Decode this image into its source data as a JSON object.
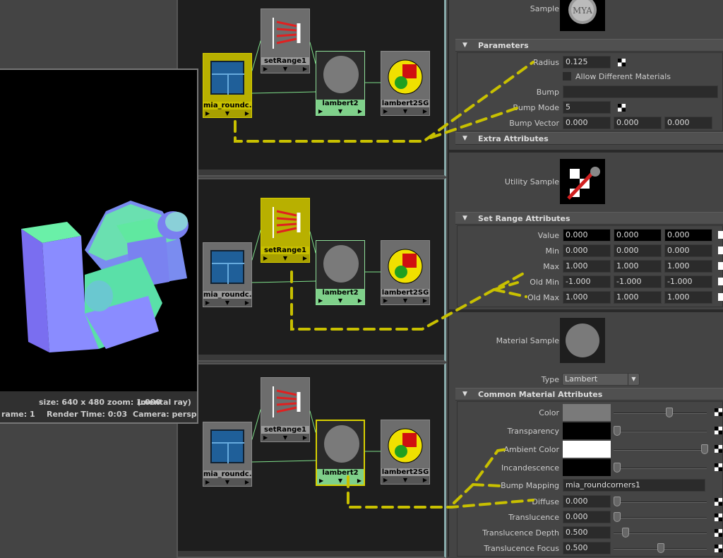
{
  "render_view": {
    "size_line": "size: 640 x 480 zoom: 1.000",
    "renderer": "(mental ray)",
    "frame": "rame: 1",
    "render_time": "Render Time: 0:03",
    "camera": "Camera: persp"
  },
  "hypershade": {
    "panels": [
      {
        "selected": "mia_roundcorners",
        "nodes": {
          "mia": "mia_roundc...",
          "setrange": "setRange1",
          "lambert": "lambert2",
          "sg": "lambert2SG"
        }
      },
      {
        "selected": "setRange1",
        "nodes": {
          "mia": "mia_roundc...",
          "setrange": "setRange1",
          "lambert": "lambert2",
          "sg": "lambert2SG"
        }
      },
      {
        "selected": "lambert2",
        "nodes": {
          "mia": "mia_roundc...",
          "setrange": "setRange1",
          "lambert": "lambert2",
          "sg": "lambert2SG"
        }
      }
    ]
  },
  "attribute_editor": {
    "sample_label": "Sample",
    "parameters": {
      "title": "Parameters",
      "radius_label": "Radius",
      "radius": "0.125",
      "allow_diff_label": "Allow Different Materials",
      "allow_diff_checked": false,
      "bump_label": "Bump",
      "bump": "",
      "bump_mode_label": "Bump Mode",
      "bump_mode": "5",
      "bump_vector_label": "Bump Vector",
      "bump_vector": [
        "0.000",
        "0.000",
        "0.000"
      ]
    },
    "extra_title": "Extra Attributes",
    "utility_sample_label": "Utility Sample",
    "set_range": {
      "title": "Set Range Attributes",
      "rows": [
        {
          "label": "Value",
          "values": [
            "0.000",
            "0.000",
            "0.000"
          ]
        },
        {
          "label": "Min",
          "values": [
            "0.000",
            "0.000",
            "0.000"
          ]
        },
        {
          "label": "Max",
          "values": [
            "1.000",
            "1.000",
            "1.000"
          ]
        },
        {
          "label": "Old Min",
          "values": [
            "-1.000",
            "-1.000",
            "-1.000"
          ]
        },
        {
          "label": "Old Max",
          "values": [
            "1.000",
            "1.000",
            "1.000"
          ]
        }
      ]
    },
    "material_sample_label": "Material Sample",
    "type_label": "Type",
    "type_value": "Lambert",
    "common": {
      "title": "Common Material Attributes",
      "color_rows": [
        {
          "label": "Color",
          "color": "#7a7a7a",
          "slider": 0.6
        },
        {
          "label": "Transparency",
          "color": "#000000",
          "slider": 0.0
        },
        {
          "label": "Ambient Color",
          "color": "#ffffff",
          "slider": 1.0
        },
        {
          "label": "Incandescence",
          "color": "#000000",
          "slider": 0.0
        }
      ],
      "bump_mapping_label": "Bump Mapping",
      "bump_mapping": "mia_roundcorners1",
      "num_rows": [
        {
          "label": "Diffuse",
          "value": "0.000",
          "slider": 0.0
        },
        {
          "label": "Translucence",
          "value": "0.000",
          "slider": 0.0
        },
        {
          "label": "Translucence Depth",
          "value": "0.500",
          "slider": 0.1
        },
        {
          "label": "Translucence Focus",
          "value": "0.500",
          "slider": 0.5
        }
      ]
    }
  },
  "colors": {
    "annotation": "#c8c000",
    "selected_node": "#b8b000",
    "connection": "#7fe08a"
  }
}
